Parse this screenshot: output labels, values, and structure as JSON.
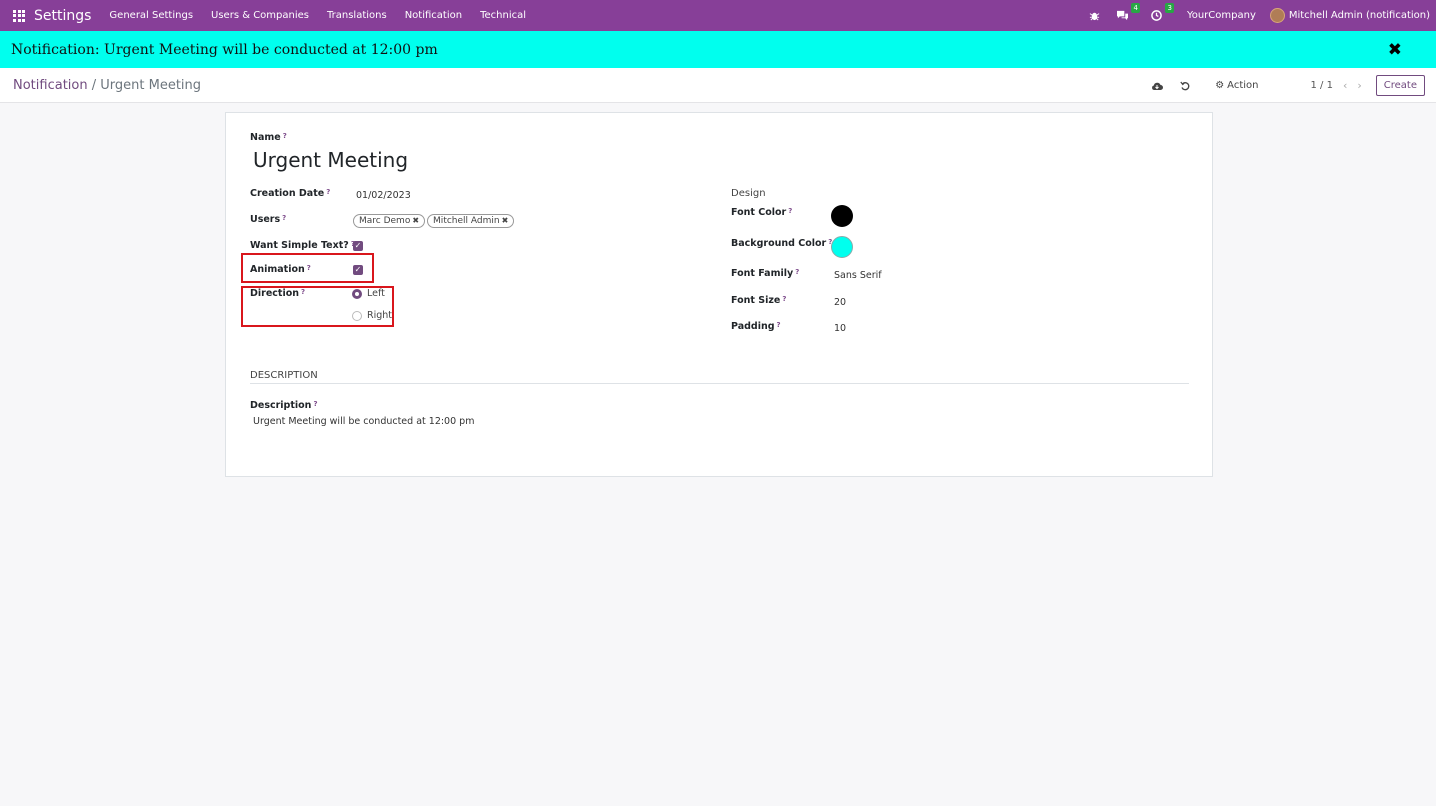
{
  "navbar": {
    "app_title": "Settings",
    "menu": [
      "General Settings",
      "Users & Companies",
      "Translations",
      "Notification",
      "Technical"
    ],
    "messages_badge": "4",
    "activities_badge": "3",
    "company": "YourCompany",
    "user": "Mitchell Admin (notification)"
  },
  "banner": {
    "text": "Notification: Urgent Meeting will be conducted at 12:00 pm",
    "background": "#00ffee"
  },
  "breadcrumb": {
    "parent": "Notification",
    "separator": "/",
    "current": "Urgent Meeting"
  },
  "control": {
    "action_label": "Action",
    "pager": "1 / 1",
    "create_label": "Create"
  },
  "form": {
    "name_label": "Name",
    "tip": "?",
    "name_value": "Urgent Meeting",
    "creation_date_label": "Creation Date",
    "creation_date_value": "01/02/2023",
    "users_label": "Users",
    "users": [
      "Marc Demo",
      "Mitchell Admin"
    ],
    "want_simple_text_label": "Want Simple Text?",
    "want_simple_text": true,
    "animation_label": "Animation",
    "animation": true,
    "direction_label": "Direction",
    "direction_options": [
      "Left",
      "Right"
    ],
    "direction_selected": "Left",
    "design_title": "Design",
    "font_color_label": "Font Color",
    "font_color": "#000000",
    "background_color_label": "Background Color",
    "background_color": "#00ffee",
    "font_family_label": "Font Family",
    "font_family_value": "Sans Serif",
    "font_size_label": "Font Size",
    "font_size_value": "20",
    "padding_label": "Padding",
    "padding_value": "10",
    "description_section": "DESCRIPTION",
    "description_label": "Description",
    "description_value": "Urgent Meeting will be conducted at 12:00 pm"
  },
  "colors": {
    "navbar": "#873f98",
    "accent": "#714b7f",
    "highlight_box": "#d9161c"
  }
}
